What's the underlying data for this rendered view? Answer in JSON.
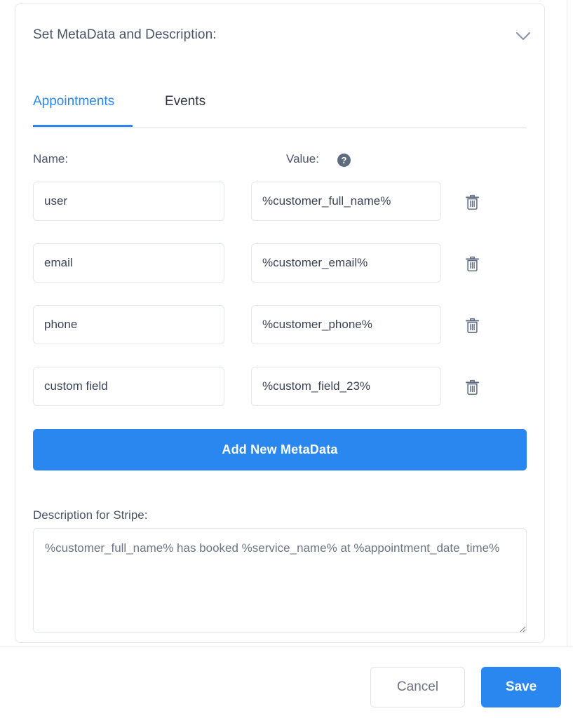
{
  "panel": {
    "title": "Set MetaData and Description:",
    "collapse_icon": "chevron-down-icon"
  },
  "tabs": [
    {
      "label": "Appointments",
      "active": true
    },
    {
      "label": "Events",
      "active": false
    }
  ],
  "columns": {
    "name_label": "Name:",
    "value_label": "Value:",
    "help_icon": "question-mark-icon",
    "help_glyph": "?"
  },
  "metadata_rows": [
    {
      "name": "user",
      "value": "%customer_full_name%",
      "delete_icon": "trash-icon"
    },
    {
      "name": "email",
      "value": "%customer_email%",
      "delete_icon": "trash-icon"
    },
    {
      "name": "phone",
      "value": "%customer_phone%",
      "delete_icon": "trash-icon"
    },
    {
      "name": "custom field",
      "value": "%custom_field_23%",
      "delete_icon": "trash-icon"
    }
  ],
  "add_button": {
    "label": "Add New MetaData"
  },
  "description": {
    "label": "Description for Stripe:",
    "value": "%customer_full_name% has booked %service_name% at %appointment_date_time%"
  },
  "footer": {
    "cancel_label": "Cancel",
    "save_label": "Save"
  },
  "colors": {
    "accent_blue": "#2b87f0",
    "text_slate": "#4a5568",
    "border_gray": "#e3e6eb",
    "icon_slate": "#5f6c80"
  }
}
